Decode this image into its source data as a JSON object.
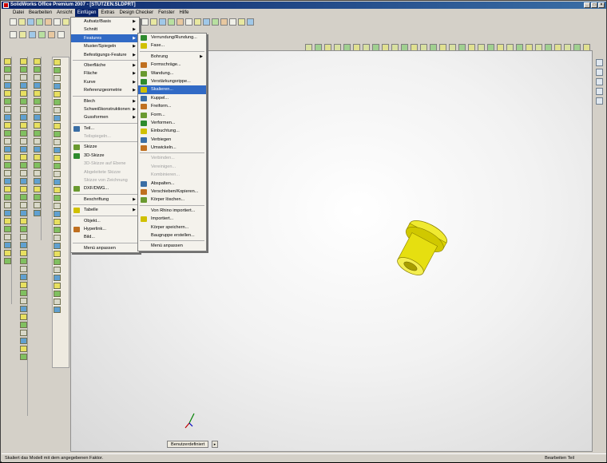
{
  "window": {
    "title": "SolidWorks Office Premium 2007 - [STÜTZEN.SLDPRT]"
  },
  "menubar": [
    {
      "label": "Datei"
    },
    {
      "label": "Bearbeiten"
    },
    {
      "label": "Ansicht"
    },
    {
      "label": "Einfügen",
      "active": true
    },
    {
      "label": "Extras"
    },
    {
      "label": "Design Checker"
    },
    {
      "label": "Fenster"
    },
    {
      "label": "Hilfe"
    }
  ],
  "insert_menu": [
    {
      "label": "Aufsatz/Basis",
      "arrow": true
    },
    {
      "label": "Schnitt",
      "arrow": true
    },
    {
      "label": "Features",
      "arrow": true,
      "highlighted": true
    },
    {
      "label": "Muster/Spiegeln",
      "arrow": true
    },
    {
      "label": "Befestigungs-Feature",
      "arrow": true
    },
    {
      "sep": true
    },
    {
      "label": "Oberfläche",
      "arrow": true
    },
    {
      "label": "Fläche",
      "arrow": true
    },
    {
      "label": "Kurve",
      "arrow": true
    },
    {
      "label": "Referenzgeometrie",
      "arrow": true
    },
    {
      "sep": true
    },
    {
      "label": "Blech",
      "arrow": true
    },
    {
      "label": "Schweißkonstruktionen",
      "arrow": true
    },
    {
      "label": "Gussformen",
      "arrow": true
    },
    {
      "sep": true
    },
    {
      "label": "Teil...",
      "icon": true
    },
    {
      "label": "Teilspiegeln...",
      "disabled": true
    },
    {
      "sep": true
    },
    {
      "label": "Skizze",
      "icon": true
    },
    {
      "label": "3D-Skizze",
      "icon": true
    },
    {
      "label": "3D-Skizze auf Ebene",
      "disabled": true
    },
    {
      "label": "Abgeleitete Skizze",
      "disabled": true
    },
    {
      "label": "Skizze von Zeichnung",
      "disabled": true
    },
    {
      "label": "DXF/DWG...",
      "icon": true
    },
    {
      "sep": true
    },
    {
      "label": "Beschriftung",
      "arrow": true
    },
    {
      "sep": true
    },
    {
      "label": "Tabelle",
      "arrow": true,
      "icon": true
    },
    {
      "sep": true
    },
    {
      "label": "Objekt..."
    },
    {
      "label": "Hyperlink...",
      "icon": true
    },
    {
      "label": "Bild..."
    },
    {
      "sep": true
    },
    {
      "label": "Menü anpassen"
    }
  ],
  "features_submenu": [
    {
      "label": "Verrundung/Rundung...",
      "icon": true
    },
    {
      "label": "Fase...",
      "icon": true
    },
    {
      "sep": true
    },
    {
      "label": "Bohrung",
      "arrow": true
    },
    {
      "label": "Formschräge...",
      "icon": true
    },
    {
      "label": "Wandung...",
      "icon": true
    },
    {
      "label": "Verstärkungsrippe...",
      "icon": true
    },
    {
      "label": "Skalieren...",
      "icon": true,
      "highlighted": true
    },
    {
      "label": "Kuppel...",
      "icon": true
    },
    {
      "label": "Freiform...",
      "icon": true
    },
    {
      "label": "Form...",
      "icon": true
    },
    {
      "label": "Verformen...",
      "icon": true
    },
    {
      "label": "Einbuchtung...",
      "icon": true
    },
    {
      "label": "Verbiegen",
      "icon": true
    },
    {
      "label": "Umwickeln...",
      "icon": true
    },
    {
      "sep": true
    },
    {
      "label": "Verbinden...",
      "disabled": true
    },
    {
      "label": "Vereinigen...",
      "disabled": true
    },
    {
      "label": "Kombinieren...",
      "disabled": true
    },
    {
      "label": "Abspalten...",
      "icon": true
    },
    {
      "label": "Verschieben/Kopieren...",
      "icon": true
    },
    {
      "label": "Körper löschen...",
      "icon": true
    },
    {
      "sep": true
    },
    {
      "label": "Von Rhino importiert..."
    },
    {
      "label": "Importiert...",
      "icon": true
    },
    {
      "label": "Körper speichern..."
    },
    {
      "label": "Baugruppe erstellen..."
    },
    {
      "sep": true
    },
    {
      "label": "Menü anpassen"
    }
  ],
  "viewport": {
    "tab_label": "Benutzerdefiniert"
  },
  "status": {
    "left_text": "Skaliert das Modell mit dem angegebenen Faktor.",
    "right_text": "Bearbeiten Teil"
  },
  "colors": {
    "title_start": "#0a246a",
    "title_end": "#3a6ea5",
    "highlight": "#316ac5",
    "part_yellow": "#e8e000"
  }
}
